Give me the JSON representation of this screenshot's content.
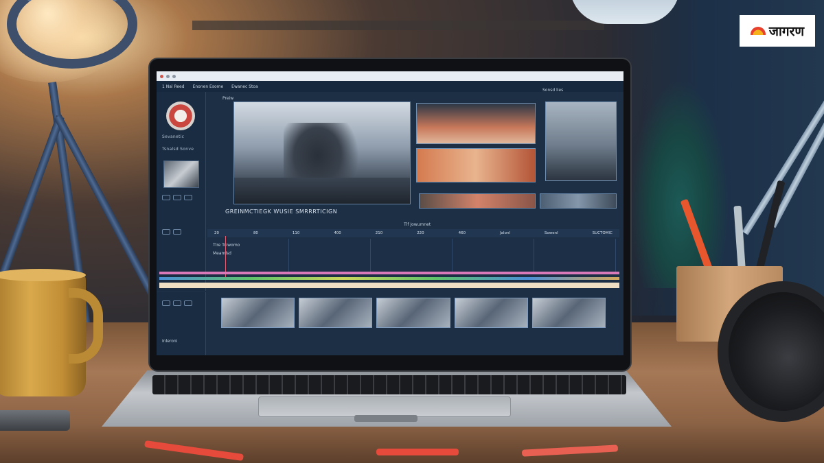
{
  "logo": {
    "text": "जागरण"
  },
  "screen": {
    "menu": [
      "1 Nal Reed",
      "Enonen Esome",
      "Ewanec Stoa"
    ],
    "left_panel": {
      "app_label": "Sevanetic",
      "sub_label": "Tsnalsd Sonve"
    },
    "preview_caption": "GREINMCTIEGK WUSIE SMRRRTICIGN",
    "panel_labels": {
      "preview": "Preiw",
      "right": "Sonsd lies",
      "center": "Tlf Jowumnet"
    },
    "ruler_marks": [
      "20",
      "80",
      "110",
      "400",
      "210",
      "220",
      "460",
      "Jalonl",
      "Sowenl",
      "SUCTOMIC"
    ],
    "track_labels": [
      "Tlre Toiwomo",
      "Meamlsd"
    ],
    "bottom_label": "Inleroni"
  },
  "colors": {
    "screen_bg": "#1d2f45",
    "accent_pink": "#d979b9",
    "accent_green": "#5fc36a",
    "accent_blue": "#4a8fd6"
  }
}
